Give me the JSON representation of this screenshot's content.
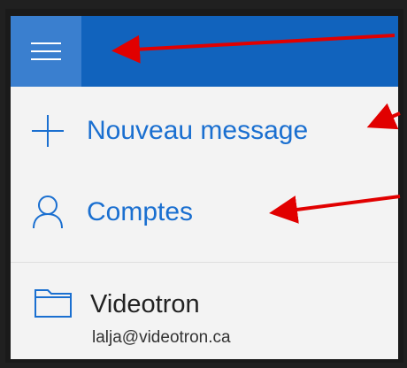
{
  "nav": {
    "menu_icon": "hamburger-icon",
    "new_message_label": "Nouveau message",
    "new_message_icon": "plus-icon",
    "accounts_label": "Comptes",
    "accounts_icon": "person-icon"
  },
  "account": {
    "icon": "folder-icon",
    "name": "Videotron",
    "email": "lalja@videotron.ca"
  },
  "colors": {
    "header": "#1163bd",
    "menu_button": "#3a7fcf",
    "link_text": "#1a6fd0",
    "panel_bg": "#f3f3f3",
    "arrow": "#e10000"
  }
}
